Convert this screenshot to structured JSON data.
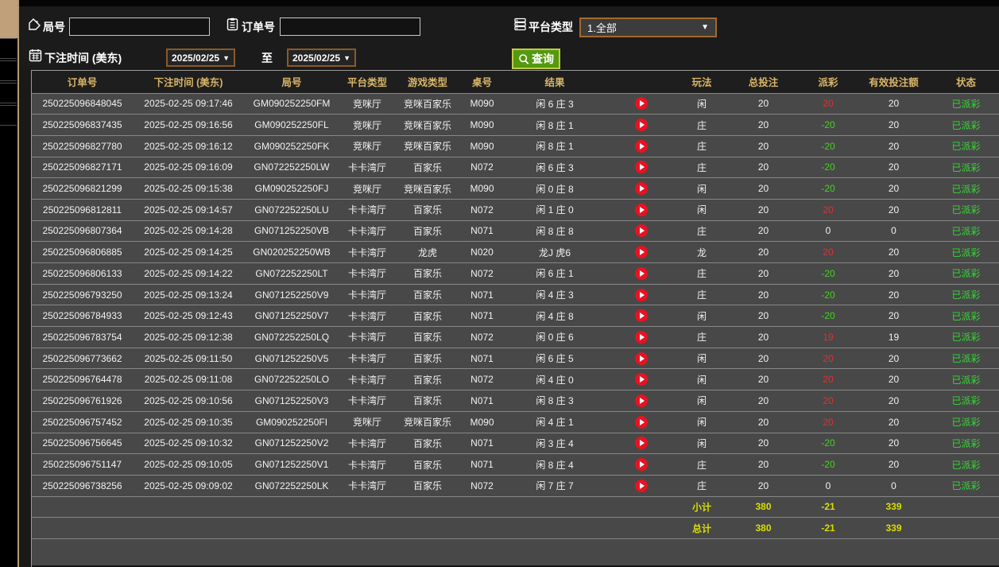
{
  "sidebar": {
    "tab": "collapse-handle",
    "box_count": 4
  },
  "filters": {
    "game_no_label": "局号",
    "game_no_value": "",
    "order_no_label": "订单号",
    "order_no_value": "",
    "platform_label": "平台类型",
    "platform_value": "1.全部",
    "bet_time_label": "下注时间 (美东)",
    "date_from": "2025/02/25",
    "to_label": "至",
    "date_to": "2025/02/25",
    "query_label": "查询"
  },
  "colors": {
    "header_text": "#d9b567",
    "row_bg": "#484848",
    "payout_positive": "#e03030",
    "payout_negative": "#43d41f",
    "status_green": "#35d835",
    "summary_yellow": "#d8df00",
    "query_button_green": "#55990f",
    "date_border_brown": "#8a5a28",
    "sidebar_tab_tan": "#bfa07b",
    "play_button_red": "#e81222"
  },
  "table": {
    "headers": [
      "订单号",
      "下注时间 (美东)",
      "局号",
      "平台类型",
      "游戏类型",
      "桌号",
      "结果",
      "",
      "玩法",
      "总投注",
      "派彩",
      "有效投注额",
      "状态"
    ],
    "rows": [
      {
        "order_no": "250225096848045",
        "bet_time": "2025-02-25 09:17:46",
        "game_no": "GM090252250FM",
        "platform": "竞咪厅",
        "game_type": "竞咪百家乐",
        "table_no": "M090",
        "result": "闲 6 庄 3",
        "play_type": "闲",
        "total_bet": "20",
        "payout": "20",
        "payout_class": "pos",
        "valid_bet": "20",
        "status": "已派彩"
      },
      {
        "order_no": "250225096837435",
        "bet_time": "2025-02-25 09:16:56",
        "game_no": "GM090252250FL",
        "platform": "竞咪厅",
        "game_type": "竞咪百家乐",
        "table_no": "M090",
        "result": "闲 8 庄 1",
        "play_type": "庄",
        "total_bet": "20",
        "payout": "-20",
        "payout_class": "neg",
        "valid_bet": "20",
        "status": "已派彩"
      },
      {
        "order_no": "250225096827780",
        "bet_time": "2025-02-25 09:16:12",
        "game_no": "GM090252250FK",
        "platform": "竞咪厅",
        "game_type": "竞咪百家乐",
        "table_no": "M090",
        "result": "闲 8 庄 1",
        "play_type": "庄",
        "total_bet": "20",
        "payout": "-20",
        "payout_class": "neg",
        "valid_bet": "20",
        "status": "已派彩"
      },
      {
        "order_no": "250225096827171",
        "bet_time": "2025-02-25 09:16:09",
        "game_no": "GN072252250LW",
        "platform": "卡卡湾厅",
        "game_type": "百家乐",
        "table_no": "N072",
        "result": "闲 6 庄 3",
        "play_type": "庄",
        "total_bet": "20",
        "payout": "-20",
        "payout_class": "neg",
        "valid_bet": "20",
        "status": "已派彩"
      },
      {
        "order_no": "250225096821299",
        "bet_time": "2025-02-25 09:15:38",
        "game_no": "GM090252250FJ",
        "platform": "竞咪厅",
        "game_type": "竞咪百家乐",
        "table_no": "M090",
        "result": "闲 0 庄 8",
        "play_type": "闲",
        "total_bet": "20",
        "payout": "-20",
        "payout_class": "neg",
        "valid_bet": "20",
        "status": "已派彩"
      },
      {
        "order_no": "250225096812811",
        "bet_time": "2025-02-25 09:14:57",
        "game_no": "GN072252250LU",
        "platform": "卡卡湾厅",
        "game_type": "百家乐",
        "table_no": "N072",
        "result": "闲 1 庄 0",
        "play_type": "闲",
        "total_bet": "20",
        "payout": "20",
        "payout_class": "pos",
        "valid_bet": "20",
        "status": "已派彩"
      },
      {
        "order_no": "250225096807364",
        "bet_time": "2025-02-25 09:14:28",
        "game_no": "GN071252250VB",
        "platform": "卡卡湾厅",
        "game_type": "百家乐",
        "table_no": "N071",
        "result": "闲 8 庄 8",
        "play_type": "庄",
        "total_bet": "20",
        "payout": "0",
        "payout_class": "zero",
        "valid_bet": "0",
        "status": "已派彩"
      },
      {
        "order_no": "250225096806885",
        "bet_time": "2025-02-25 09:14:25",
        "game_no": "GN020252250WB",
        "platform": "卡卡湾厅",
        "game_type": "龙虎",
        "table_no": "N020",
        "result": "龙J 虎6",
        "play_type": "龙",
        "total_bet": "20",
        "payout": "20",
        "payout_class": "pos",
        "valid_bet": "20",
        "status": "已派彩"
      },
      {
        "order_no": "250225096806133",
        "bet_time": "2025-02-25 09:14:22",
        "game_no": "GN072252250LT",
        "platform": "卡卡湾厅",
        "game_type": "百家乐",
        "table_no": "N072",
        "result": "闲 6 庄 1",
        "play_type": "庄",
        "total_bet": "20",
        "payout": "-20",
        "payout_class": "neg",
        "valid_bet": "20",
        "status": "已派彩"
      },
      {
        "order_no": "250225096793250",
        "bet_time": "2025-02-25 09:13:24",
        "game_no": "GN071252250V9",
        "platform": "卡卡湾厅",
        "game_type": "百家乐",
        "table_no": "N071",
        "result": "闲 4 庄 3",
        "play_type": "庄",
        "total_bet": "20",
        "payout": "-20",
        "payout_class": "neg",
        "valid_bet": "20",
        "status": "已派彩"
      },
      {
        "order_no": "250225096784933",
        "bet_time": "2025-02-25 09:12:43",
        "game_no": "GN071252250V7",
        "platform": "卡卡湾厅",
        "game_type": "百家乐",
        "table_no": "N071",
        "result": "闲 4 庄 8",
        "play_type": "闲",
        "total_bet": "20",
        "payout": "-20",
        "payout_class": "neg",
        "valid_bet": "20",
        "status": "已派彩"
      },
      {
        "order_no": "250225096783754",
        "bet_time": "2025-02-25 09:12:38",
        "game_no": "GN072252250LQ",
        "platform": "卡卡湾厅",
        "game_type": "百家乐",
        "table_no": "N072",
        "result": "闲 0 庄 6",
        "play_type": "庄",
        "total_bet": "20",
        "payout": "19",
        "payout_class": "pos",
        "valid_bet": "19",
        "status": "已派彩"
      },
      {
        "order_no": "250225096773662",
        "bet_time": "2025-02-25 09:11:50",
        "game_no": "GN071252250V5",
        "platform": "卡卡湾厅",
        "game_type": "百家乐",
        "table_no": "N071",
        "result": "闲 6 庄 5",
        "play_type": "闲",
        "total_bet": "20",
        "payout": "20",
        "payout_class": "pos",
        "valid_bet": "20",
        "status": "已派彩"
      },
      {
        "order_no": "250225096764478",
        "bet_time": "2025-02-25 09:11:08",
        "game_no": "GN072252250LO",
        "platform": "卡卡湾厅",
        "game_type": "百家乐",
        "table_no": "N072",
        "result": "闲 4 庄 0",
        "play_type": "闲",
        "total_bet": "20",
        "payout": "20",
        "payout_class": "pos",
        "valid_bet": "20",
        "status": "已派彩"
      },
      {
        "order_no": "250225096761926",
        "bet_time": "2025-02-25 09:10:56",
        "game_no": "GN071252250V3",
        "platform": "卡卡湾厅",
        "game_type": "百家乐",
        "table_no": "N071",
        "result": "闲 8 庄 3",
        "play_type": "闲",
        "total_bet": "20",
        "payout": "20",
        "payout_class": "pos",
        "valid_bet": "20",
        "status": "已派彩"
      },
      {
        "order_no": "250225096757452",
        "bet_time": "2025-02-25 09:10:35",
        "game_no": "GM090252250FI",
        "platform": "竞咪厅",
        "game_type": "竞咪百家乐",
        "table_no": "M090",
        "result": "闲 4 庄 1",
        "play_type": "闲",
        "total_bet": "20",
        "payout": "20",
        "payout_class": "pos",
        "valid_bet": "20",
        "status": "已派彩"
      },
      {
        "order_no": "250225096756645",
        "bet_time": "2025-02-25 09:10:32",
        "game_no": "GN071252250V2",
        "platform": "卡卡湾厅",
        "game_type": "百家乐",
        "table_no": "N071",
        "result": "闲 3 庄 4",
        "play_type": "闲",
        "total_bet": "20",
        "payout": "-20",
        "payout_class": "neg",
        "valid_bet": "20",
        "status": "已派彩"
      },
      {
        "order_no": "250225096751147",
        "bet_time": "2025-02-25 09:10:05",
        "game_no": "GN071252250V1",
        "platform": "卡卡湾厅",
        "game_type": "百家乐",
        "table_no": "N071",
        "result": "闲 8 庄 4",
        "play_type": "庄",
        "total_bet": "20",
        "payout": "-20",
        "payout_class": "neg",
        "valid_bet": "20",
        "status": "已派彩"
      },
      {
        "order_no": "250225096738256",
        "bet_time": "2025-02-25 09:09:02",
        "game_no": "GN072252250LK",
        "platform": "卡卡湾厅",
        "game_type": "百家乐",
        "table_no": "N072",
        "result": "闲 7 庄 7",
        "play_type": "庄",
        "total_bet": "20",
        "payout": "0",
        "payout_class": "zero",
        "valid_bet": "0",
        "status": "已派彩"
      }
    ],
    "summary": [
      {
        "label": "小计",
        "total_bet": "380",
        "payout": "-21",
        "valid_bet": "339"
      },
      {
        "label": "总计",
        "total_bet": "380",
        "payout": "-21",
        "valid_bet": "339"
      }
    ]
  }
}
